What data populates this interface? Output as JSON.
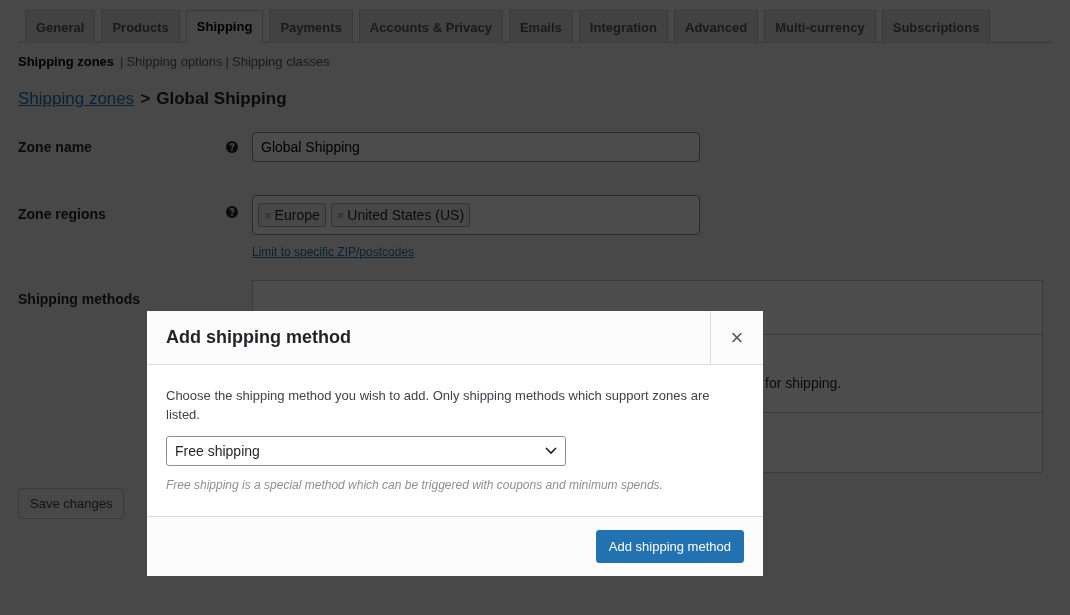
{
  "tabs": [
    {
      "label": "General",
      "selected": false
    },
    {
      "label": "Products",
      "selected": false
    },
    {
      "label": "Shipping",
      "selected": true
    },
    {
      "label": "Payments",
      "selected": false
    },
    {
      "label": "Accounts & Privacy",
      "selected": false
    },
    {
      "label": "Emails",
      "selected": false
    },
    {
      "label": "Integration",
      "selected": false
    },
    {
      "label": "Advanced",
      "selected": false
    },
    {
      "label": "Multi-currency",
      "selected": false
    },
    {
      "label": "Subscriptions",
      "selected": false
    }
  ],
  "subnav": [
    {
      "label": "Shipping zones",
      "selected": true
    },
    {
      "separator": "|",
      "label": "Shipping options",
      "selected": false
    },
    {
      "separator": "|",
      "label": "Shipping classes",
      "selected": false
    }
  ],
  "breadcrumb": {
    "link": "Shipping zones",
    "separator": ">",
    "current": "Global Shipping"
  },
  "zone_name": {
    "label": "Zone name",
    "value": "Global Shipping"
  },
  "zone_regions": {
    "label": "Zone regions",
    "tags": [
      {
        "remove": "×",
        "label": "Europe"
      },
      {
        "remove": "×",
        "label": "United States (US)"
      }
    ],
    "link": "Limit to specific ZIP/postcodes"
  },
  "shipping_methods": {
    "label": "Shipping methods",
    "rows": [
      "",
      "for shipping.",
      ""
    ]
  },
  "save_button": {
    "label": "Save changes",
    "disabled": true
  },
  "modal": {
    "title": "Add shipping method",
    "close": "×",
    "description": "Choose the shipping method you wish to add. Only shipping methods which support zones are listed.",
    "select": {
      "value": "Free shipping"
    },
    "hint": "Free shipping is a special method which can be triggered with coupons and minimum spends.",
    "button": "Add shipping method"
  }
}
